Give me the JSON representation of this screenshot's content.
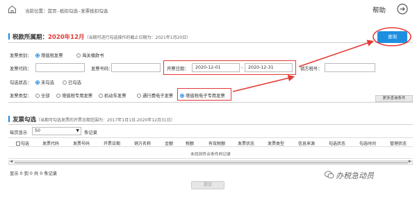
{
  "header": {
    "breadcrumb_label": "当前位置：",
    "breadcrumb": [
      "首页",
      "抵扣勾选",
      "发票抵扣勾选"
    ],
    "breadcrumb_sep": "-",
    "help": "帮助"
  },
  "period": {
    "label": "税款所属期：",
    "value": "2020年12月",
    "note": "（当期可进行勾选操作的截止日期为：2021年1月20日）"
  },
  "filters": {
    "invoice_category_label": "发票类别：",
    "invoice_category_options": [
      "增值税发票",
      "海关缴款书"
    ],
    "invoice_code_label": "发票代码：",
    "invoice_code_value": "",
    "invoice_number_label": "发票号码：",
    "invoice_number_value": "",
    "date_label": "开票日期：",
    "date_from": "2020-12-01",
    "date_sep": "-",
    "date_to": "2020-12-31",
    "seller_tax_label": "销方税号：",
    "seller_tax_value": "",
    "select_status_label": "勾选状态：",
    "select_status_options": [
      "未勾选",
      "已勾选"
    ],
    "invoice_type_label": "发票类型：",
    "invoice_type_options": [
      "全部",
      "增值税专用发票",
      "机动车发票",
      "通行费电子发票",
      "增值税电子专用发票"
    ],
    "query_button": "查询",
    "more_button": "更多查询条件"
  },
  "list": {
    "title": "发票勾选",
    "note": "（当期可勾选发票的开票日期范围为：2017年1月1日-2020年12月31日）",
    "page_size_label": "每页显示",
    "page_size_value": "50",
    "page_size_unit": "条记录",
    "columns": [
      "勾选",
      "发票代码",
      "发票号码",
      "开票日期",
      "销方名称",
      "金额",
      "税额",
      "有效税额",
      "发票状态",
      "发票类型",
      "信息来源",
      "勾选状态",
      "勾选时间",
      "管理状态"
    ],
    "empty_text": "未找到符合条件的记录",
    "summary": "显示 0 到 0 共 0 条记录",
    "submit_button": "提交"
  },
  "watermark": "办税急动员"
}
